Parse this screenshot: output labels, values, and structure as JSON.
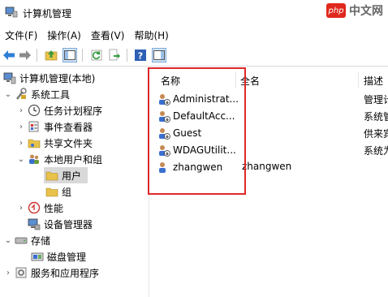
{
  "window": {
    "title": "计算机管理"
  },
  "watermark": {
    "logo_text": "php",
    "text": "中文网"
  },
  "menu": {
    "items": [
      "文件(F)",
      "操作(A)",
      "查看(V)",
      "帮助(H)"
    ]
  },
  "toolbar": {
    "icons": [
      "back-arrow-icon",
      "forward-arrow-icon",
      "up-folder-icon",
      "show-hide-tree-icon",
      "refresh-icon",
      "export-list-icon",
      "help-icon",
      "show-action-pane-icon"
    ]
  },
  "tree": {
    "root": "计算机管理(本地)",
    "system_tools": "系统工具",
    "task_scheduler": "任务计划程序",
    "event_viewer": "事件查看器",
    "shared_folders": "共享文件夹",
    "local_users_groups": "本地用户和组",
    "users": "用户",
    "groups": "组",
    "performance": "性能",
    "device_manager": "设备管理器",
    "storage": "存储",
    "disk_management": "磁盘管理",
    "services_apps": "服务和应用程序"
  },
  "list": {
    "columns": [
      "名称",
      "全名",
      "描述"
    ],
    "rows": [
      {
        "name": "Administrat...",
        "fullname": "",
        "desc": "管理计"
      },
      {
        "name": "DefaultAcc...",
        "fullname": "",
        "desc": "系统管"
      },
      {
        "name": "Guest",
        "fullname": "",
        "desc": "供来宾"
      },
      {
        "name": "WDAGUtilit...",
        "fullname": "",
        "desc": "系统为"
      },
      {
        "name": "zhangwen",
        "fullname": "zhangwen",
        "desc": ""
      }
    ]
  },
  "highlight_color": "#e0282a",
  "selection_color": "#d9d9d9"
}
